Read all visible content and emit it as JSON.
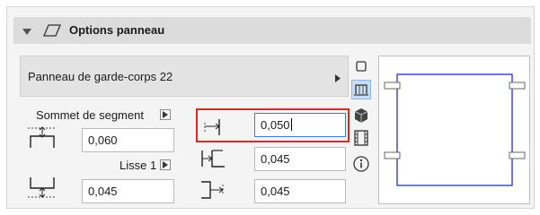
{
  "header": {
    "title": "Options panneau"
  },
  "selector": {
    "label": "Panneau de garde-corps 22"
  },
  "segment": {
    "top_label": "Sommet de segment",
    "top_value": "0,060",
    "rail_label": "Lisse 1",
    "rail_value": "0,045"
  },
  "offsets": {
    "field1_value": "0,050",
    "field2_value": "0,045",
    "field3_value": "0,045"
  },
  "toolbar": {
    "tools": [
      "panel-shape-icon",
      "railing-panel-icon",
      "3d-cube-icon",
      "film-strip-icon",
      "info-icon"
    ]
  },
  "colors": {
    "highlight": "#e02424",
    "active_field_border": "#3d7ad6",
    "preview_stroke": "#3a3ad8"
  }
}
